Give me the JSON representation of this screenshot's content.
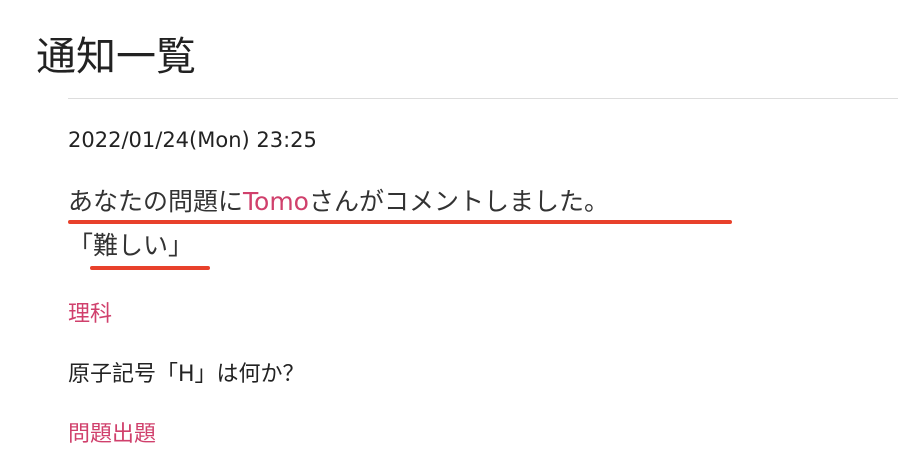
{
  "page_title": "通知一覧",
  "notification": {
    "datetime": "2022/01/24(Mon) 23:25",
    "message_prefix": "あなたの問題に",
    "user_name": "Tomo",
    "message_suffix": "さんがコメントしました。",
    "comment": "「難しい」",
    "category": "理科",
    "question": "原子記号「H」は何か？",
    "question_link": "問題出題"
  },
  "colors": {
    "link": "#d0406c",
    "annotation": "#e8412b"
  }
}
